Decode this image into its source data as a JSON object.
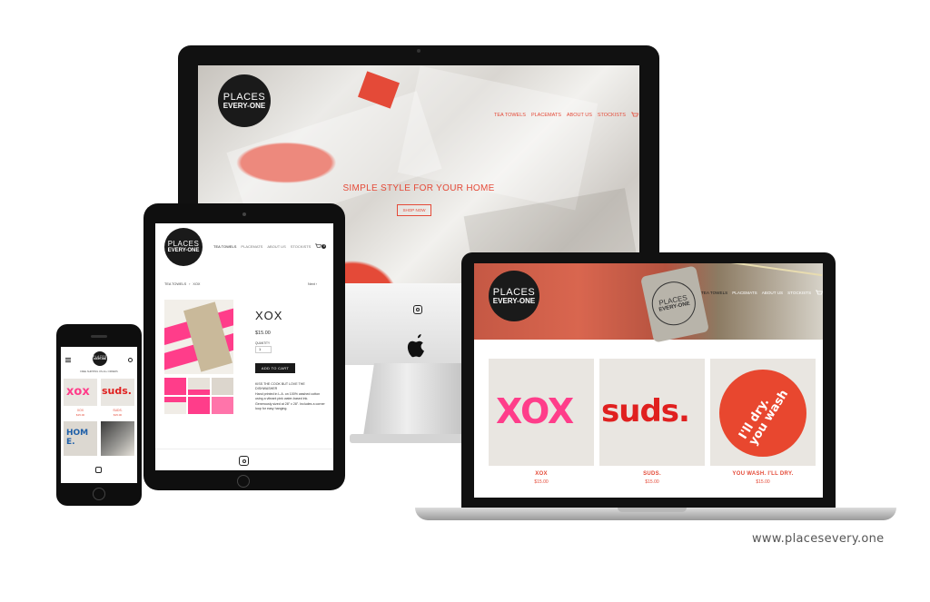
{
  "brand": {
    "name_line1": "PLACES",
    "name_line2": "EVERY-ONE",
    "accent_color": "#e44a38",
    "website": "www.placesevery.one"
  },
  "desktop": {
    "nav": [
      "TEA TOWELS",
      "PLACEMATS",
      "ABOUT US",
      "STOCKISTS"
    ],
    "cart_count": "0",
    "hero_heading": "SIMPLE STYLE FOR YOUR HOME",
    "hero_button": "SHOP NOW",
    "footer_icon": "instagram-icon"
  },
  "tablet": {
    "nav": [
      "TEA TOWELS",
      "PLACEMATS",
      "ABOUT US",
      "STOCKISTS"
    ],
    "cart_count": "0",
    "breadcrumb": [
      "TEA TOWELS",
      "XOX"
    ],
    "next_link": "Next ›",
    "product": {
      "title": "XOX",
      "price": "$15.00",
      "quantity_label": "QUANTITY",
      "quantity_value": "1",
      "add_to_cart": "ADD TO CART",
      "description_line1": "KISS THE COOK BUT LOVE THE DISHWASHER",
      "description_line2": "Hand printed in L.A. on 100% washed cotton using a vibrant pink water-based ink.",
      "description_line3": "Generously sized at 28\" x 28\". Includes a corner loop for easy hanging."
    }
  },
  "phone": {
    "banner": "FREE SHIPPING ON ALL ORDERS",
    "products": [
      {
        "word": "xox",
        "name": "XOX",
        "price": "$15.00"
      },
      {
        "word": "suds.",
        "name": "SUDS.",
        "price": "$15.00"
      }
    ],
    "tiles_row2": [
      "HOME."
    ]
  },
  "laptop": {
    "nav": [
      "TEA TOWELS",
      "PLACEMATS",
      "ABOUT US",
      "STOCKISTS"
    ],
    "cart_count": "0",
    "tag_text_1": "PLACES",
    "tag_text_2": "EVERY-ONE",
    "products": [
      {
        "word": "XOX",
        "name": "XOX",
        "price": "$15.00",
        "color": "#ff3d8a"
      },
      {
        "word": "suds.",
        "name": "SUDS.",
        "price": "$15.00",
        "color": "#e0201f"
      },
      {
        "word": "I'll dry. you wash",
        "name": "YOU WASH. I'LL DRY.",
        "price": "$15.00",
        "color": "#e8472f"
      }
    ]
  }
}
